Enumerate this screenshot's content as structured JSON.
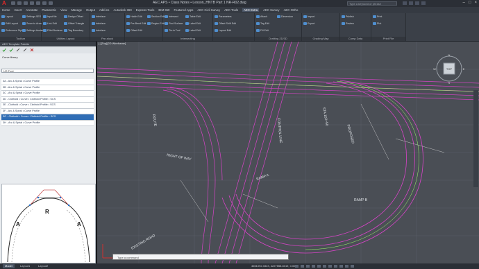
{
  "titlebar": {
    "app_logo": "A",
    "title": "AEC APS • Class Notes • Lesson_HNTB Part 1 NR-R02.dwg",
    "search_placeholder": "Type a keyword or phrase",
    "controls": [
      "–",
      "□",
      "×"
    ]
  },
  "ribbon_tabs": [
    "Home",
    "Insert",
    "Annotate",
    "Parametric",
    "View",
    "Manage",
    "Output",
    "Add-ins",
    "Autodesk 360",
    "Express Tools",
    "BIM 360",
    "Featured Apps",
    "AEC Civil Survey",
    "AEC Tools",
    "AEC Extra",
    "AEC Survey",
    "AEC Ortho"
  ],
  "active_tab_index": 14,
  "ribbon": {
    "panels": [
      {
        "title": "Toolbar",
        "buttons": [
          "Layout",
          "Edit Layout",
          "Reference Style",
          "Settings SES",
          "Zoom to Area",
          "Settings Assistant"
        ]
      },
      {
        "title": "Utilities Layout",
        "buttons": [
          "Input file",
          "Link Edit",
          "Fillet Boolean",
          "Design Offset",
          "Offset Triangle",
          "Tag Boundary"
        ]
      },
      {
        "title": "Pre-stock",
        "buttons": [
          "Interface",
          "Interface",
          "Interface"
        ]
      },
      {
        "title": "",
        "buttons": [
          "Hatch Edit",
          "Pre-Bend Edit",
          "Offset Edit",
          "Section Edit",
          "Region Edit"
        ]
      },
      {
        "title": "Intersecting",
        "buttons": [
          "Intersect",
          "Find Surface",
          "Tie-in Tool",
          "Table Edit",
          "Label Edit",
          "Label Edit"
        ]
      },
      {
        "title": "",
        "buttons": [
          "Parameters",
          "Offset Shift Edit",
          "Layout Edit"
        ]
      },
      {
        "title": "Drafting 2D/3D",
        "buttons": [
          "Attach",
          "Tag Edit",
          "Fill Edit",
          "Dimension"
        ]
      },
      {
        "title": "Grading Map",
        "buttons": [
          "Import",
          "Export"
        ]
      },
      {
        "title": "Comp Data",
        "buttons": [
          "Publish",
          "Review"
        ]
      },
      {
        "title": "Print File",
        "buttons": [
          "Print",
          "Plot"
        ]
      }
    ]
  },
  "left_panel": {
    "header": "AEC Template Palette",
    "toolbar_icons": [
      "check-icon",
      "check-icon",
      "edit-icon",
      "pin-icon",
      "delete-icon"
    ],
    "label": "Curve library",
    "combo_value": "US Foot",
    "items": [
      "3A - Arc & Spiral • Curve Profile",
      "3B - Arc & Spiral • Curve Profile",
      "3C - Arc & Spiral • Curve Profile",
      "3D - Clothoid • Curve • Clothoid Profile • SCS",
      "3E - Clothoid • Curve • Clothoid Profile • SCS",
      "3F - Arc & Spiral • Curve Profile",
      "3G - Clothoid • Curve • Clothoid Profile • SCS",
      "3H - Arc & Spiral • Curve Profile"
    ],
    "selected_index": 6,
    "preview_labels": {
      "left": "A",
      "center": "R",
      "right": "A"
    }
  },
  "canvas": {
    "viewport_label": "[-][Top][2D Wireframe]",
    "road_labels": [
      "ROUTE",
      "RIGHT OF WAY",
      "CONTROL LINE",
      "STA 102+50",
      "PROPOSED",
      "RAMP A",
      "RAMP B",
      "EXISTING ROAD"
    ],
    "colors": {
      "background": "#4a4e55",
      "road_lines": "#d844c8",
      "grid": "#6a6e75",
      "center": "#9eff6a",
      "dim": "#dfe3e7"
    }
  },
  "command_line": {
    "placeholder": "Type a command"
  },
  "statusbar": {
    "layout_tabs": [
      "Model",
      "Layout1",
      "Layout2"
    ],
    "active_layout": 0,
    "coordinates": "4651092.3323, 4227558.8319, 0.0000",
    "model_label": "MODEL"
  },
  "viewcube": {
    "face": "TOP",
    "compass": [
      "N",
      "E",
      "S",
      "W"
    ],
    "wcs": "WCS"
  }
}
